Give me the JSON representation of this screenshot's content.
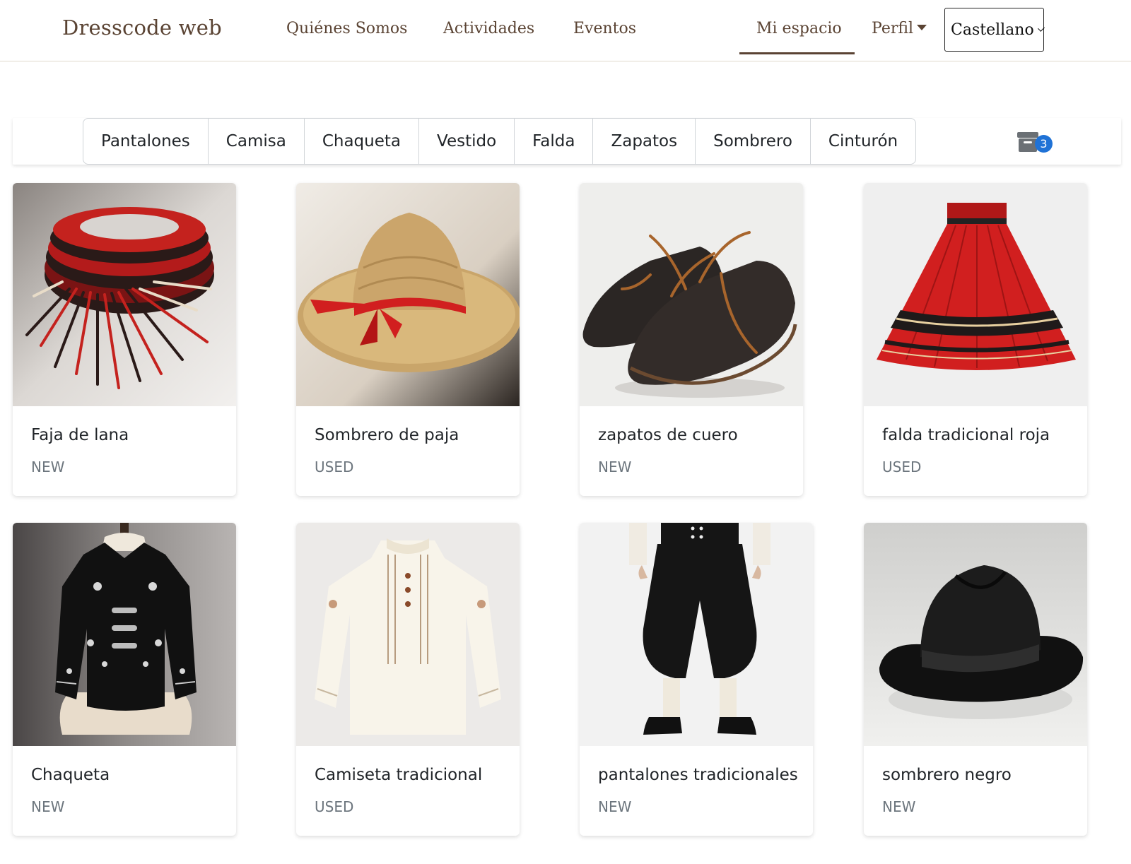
{
  "nav": {
    "brand": "Dresscode web",
    "links": [
      "Quiénes Somos",
      "Actividades",
      "Eventos"
    ],
    "mi_espacio": "Mi espacio",
    "perfil": "Perfil",
    "language": "Castellano"
  },
  "categories": [
    "Pantalones",
    "Camisa",
    "Chaqueta",
    "Vestido",
    "Falda",
    "Zapatos",
    "Sombrero",
    "Cinturón"
  ],
  "archive": {
    "icon": "archive-icon",
    "count": "3",
    "badge_color": "#1f72d6"
  },
  "products": [
    {
      "title": "Faja de lana",
      "condition": "NEW"
    },
    {
      "title": "Sombrero de paja",
      "condition": "USED"
    },
    {
      "title": "zapatos de cuero",
      "condition": "NEW"
    },
    {
      "title": "falda tradicional roja",
      "condition": "USED"
    },
    {
      "title": "Chaqueta",
      "condition": "NEW"
    },
    {
      "title": "Camiseta tradicional",
      "condition": "USED"
    },
    {
      "title": "pantalones tradicionales",
      "condition": "NEW"
    },
    {
      "title": "sombrero negro",
      "condition": "NEW"
    }
  ],
  "colors": {
    "brand": "#5a4333",
    "text": "#212529",
    "muted": "#6c757d"
  }
}
